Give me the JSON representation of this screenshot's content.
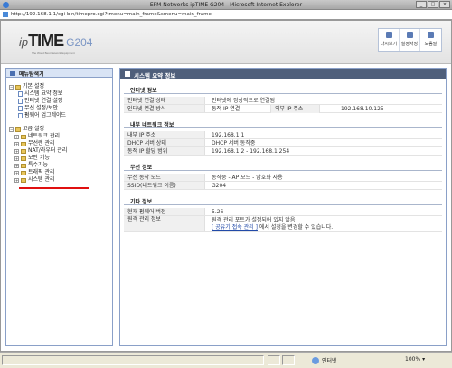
{
  "window": {
    "title": "EFM Networks ipTIME G204 - Microsoft Internet Explorer"
  },
  "address": {
    "url": "http://192.168.1.1/cgi-bin/timepro.cgi?tmenu=main_frame&smenu=main_frame"
  },
  "header": {
    "logo_ip": "ip",
    "logo_time": "TIME",
    "logo_model": "G204",
    "logo_tagline": "The World Best Network Equipment",
    "buttons": [
      {
        "label": "다시보기"
      },
      {
        "label": "설정저장"
      },
      {
        "label": "도움말"
      }
    ]
  },
  "nav": {
    "title": "메뉴탐색기",
    "basic": {
      "label": "기본 설정",
      "items": [
        {
          "label": "시스템 요약 정보"
        },
        {
          "label": "인터넷 연결 설정"
        },
        {
          "label": "무선 설정/보안"
        },
        {
          "label": "펌웨어 업그레이드"
        }
      ]
    },
    "advanced": {
      "label": "고급 설정",
      "items": [
        {
          "label": "네트워크 관리"
        },
        {
          "label": "무선랜 관리"
        },
        {
          "label": "NAT/라우터 관리"
        },
        {
          "label": "보안 기능"
        },
        {
          "label": "특수기능"
        },
        {
          "label": "트래픽 관리"
        },
        {
          "label": "시스템 관리"
        }
      ]
    }
  },
  "main": {
    "title": "시스템 요약 정보",
    "internet": {
      "title": "인터넷 정보",
      "status_label": "인터넷 연결 상태",
      "status_value": "인터넷에 정상적으로 연결됨",
      "method_label": "인터넷 연결 방식",
      "method_value": "동적 IP 연결",
      "ext_ip_label": "외부 IP 주소",
      "ext_ip_value": "192.168.10.125"
    },
    "lan": {
      "title": "내부 네트워크 정보",
      "rows": [
        {
          "label": "내부 IP 주소",
          "value": "192.168.1.1"
        },
        {
          "label": "DHCP 서버 상태",
          "value": "DHCP 서버 동작중"
        },
        {
          "label": "동적 IP 할당 범위",
          "value": "192.168.1.2 - 192.168.1.254"
        }
      ]
    },
    "wireless": {
      "title": "무선 정보",
      "rows": [
        {
          "label": "무선 동작 모드",
          "value": "동작중 - AP 모드 - 암호화 사용"
        },
        {
          "label": "SSID(네트워크 이름)",
          "value": "G204"
        }
      ]
    },
    "other": {
      "title": "기타 정보",
      "fw_label": "현재 펌웨어 버전",
      "fw_value": "5.26",
      "remote_label": "원격 관리 정보",
      "remote_line1": "원격 관리 포트가 설정되어 있지 않음",
      "remote_link": "[ 공유기 접속 관리 ]",
      "remote_line2_rest": "에서 설정을 변경할 수 있습니다."
    }
  },
  "statusbar": {
    "zone": "인터넷",
    "zoom": "100%"
  }
}
